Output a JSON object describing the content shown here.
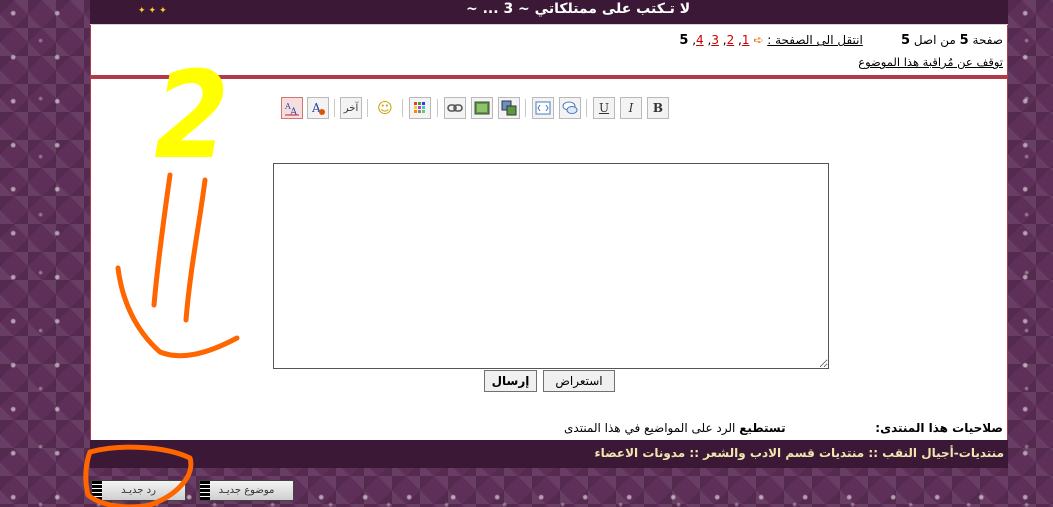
{
  "header": {
    "title": "لا تـكتب على ممتلكاتي ~ 3 ... ~",
    "arrows": "✦✦✦"
  },
  "pagination": {
    "page_word": "صفحة",
    "current": "5",
    "of_word": "من اصل",
    "total": "5",
    "goto_label": "انتقل الى الصفحة :",
    "pages": [
      "1",
      "2",
      "3",
      "4",
      "5"
    ],
    "unwatch": "توقف عن مُراقبة هذا الموضوع"
  },
  "toolbar": {
    "bold": "B",
    "italic": "I",
    "underline": "U",
    "other": "آخر",
    "smiley": "☺"
  },
  "editor": {
    "value": ""
  },
  "buttons": {
    "send": "إرسال",
    "preview": "استعراض"
  },
  "permissions": {
    "label": "صلاحيات هذا المنتدى:",
    "text_bold": "تستطيع",
    "text": "الرد على المواضيع في هذا المنتدى"
  },
  "breadcrumb": {
    "text": "منتديات-أجيال النقب :: منتديات قسم الادب والشعر :: مدونات الاعضاء"
  },
  "bottom_buttons": {
    "new_reply": "رد جديـد",
    "new_topic": "موضوع جديـد"
  },
  "annotation": {
    "number": "2"
  },
  "colors": {
    "panel_border": "#b13a4a",
    "dark_bar": "#3b1836",
    "page_link": "#cc0000",
    "annotation_yellow": "#ffff00",
    "annotation_orange": "#ff6600"
  }
}
